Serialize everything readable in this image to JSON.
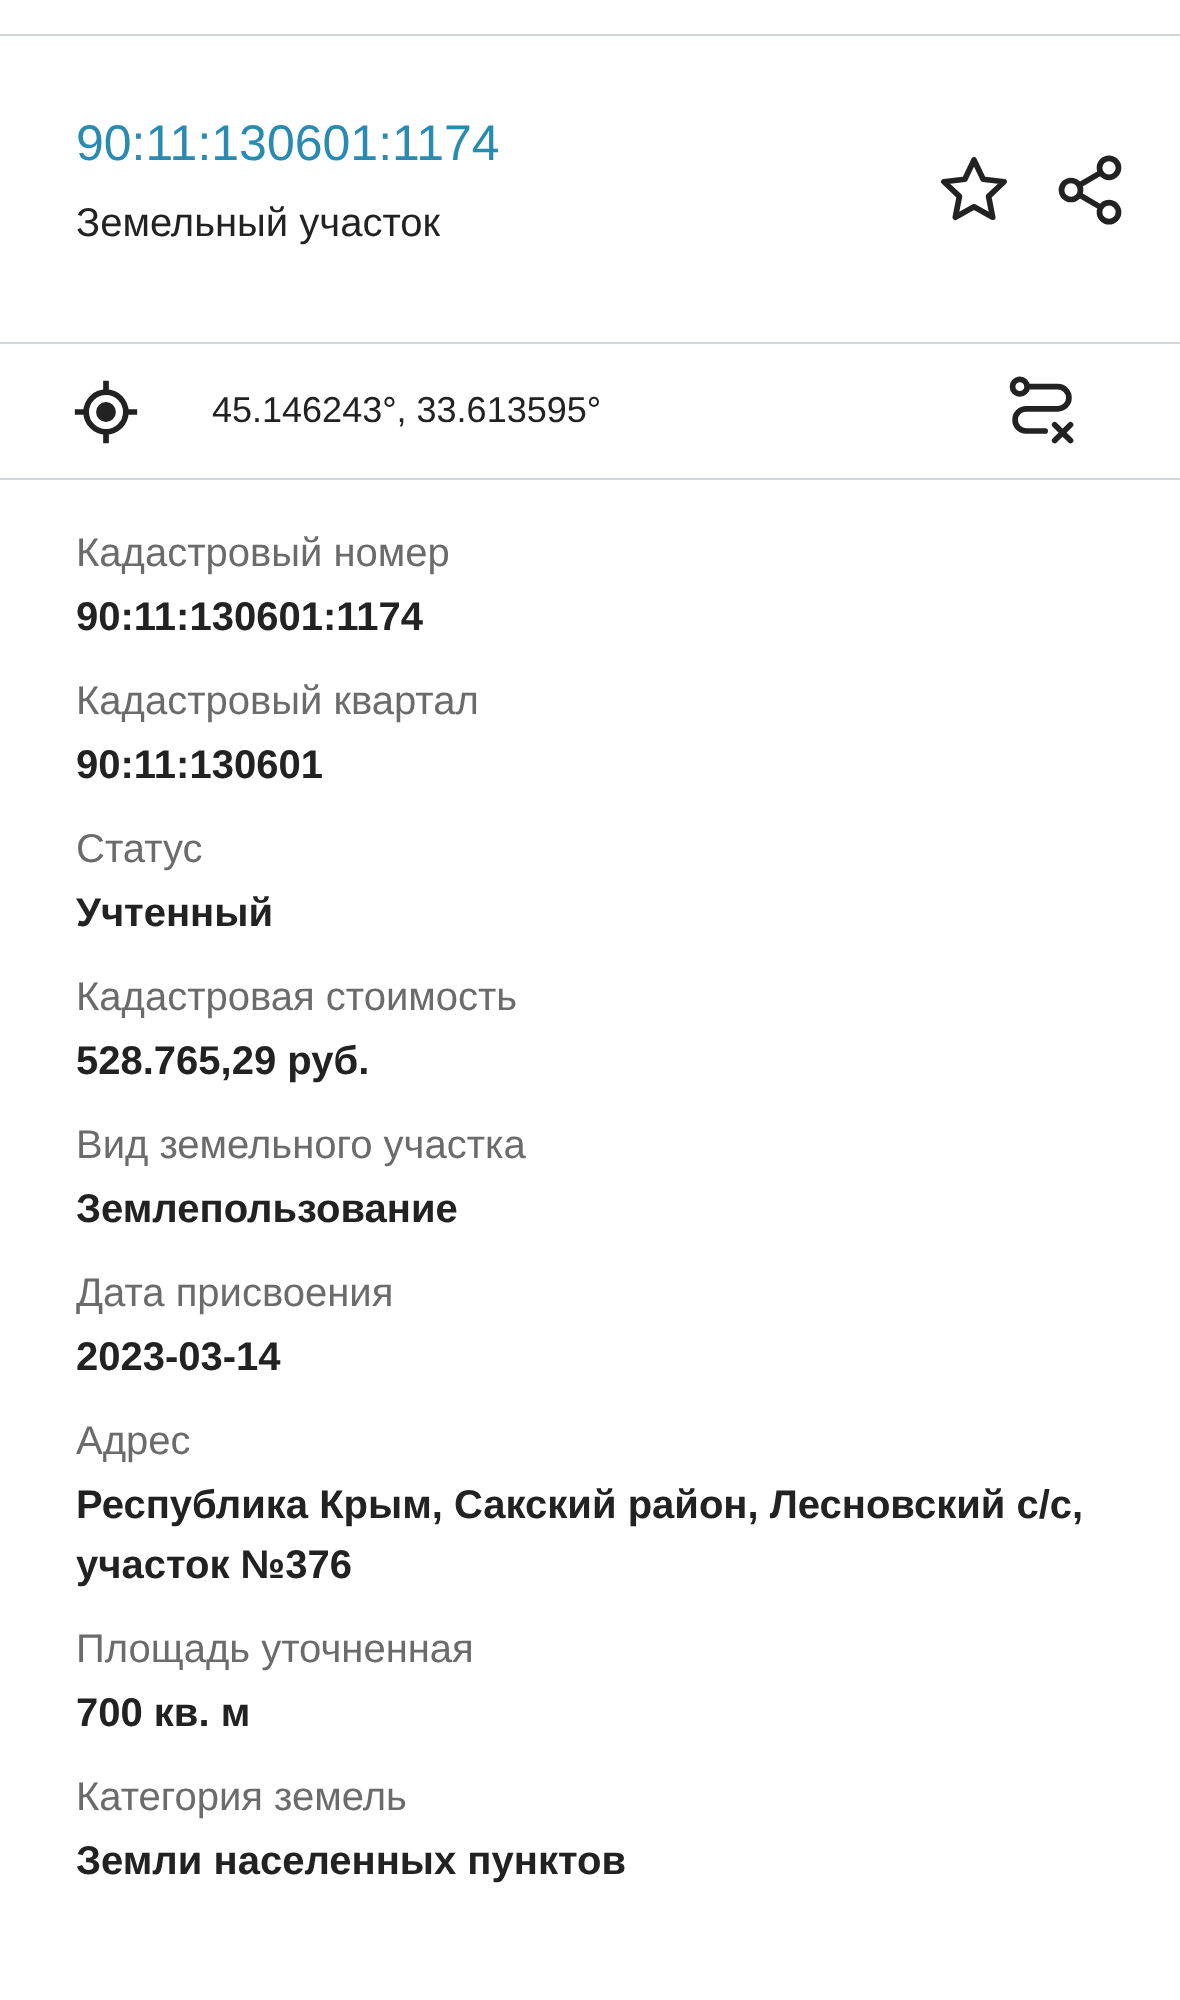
{
  "header": {
    "title": "90:11:130601:1174",
    "subtitle": "Земельный участок"
  },
  "coordinates": "45.146243°, 33.613595°",
  "fields": [
    {
      "label": "Кадастровый номер",
      "value": "90:11:130601:1174"
    },
    {
      "label": "Кадастровый квартал",
      "value": "90:11:130601"
    },
    {
      "label": "Статус",
      "value": "Учтенный"
    },
    {
      "label": "Кадастровая стоимость",
      "value": "528.765,29 руб."
    },
    {
      "label": "Вид земельного участка",
      "value": "Землепользование"
    },
    {
      "label": "Дата присвоения",
      "value": "2023-03-14"
    },
    {
      "label": "Адрес",
      "value": "Республика Крым, Сакский район, Лесновский с/с, участок №376"
    },
    {
      "label": "Площадь уточненная",
      "value": "700 кв. м"
    },
    {
      "label": "Категория земель",
      "value": "Земли населенных пунктов"
    }
  ]
}
